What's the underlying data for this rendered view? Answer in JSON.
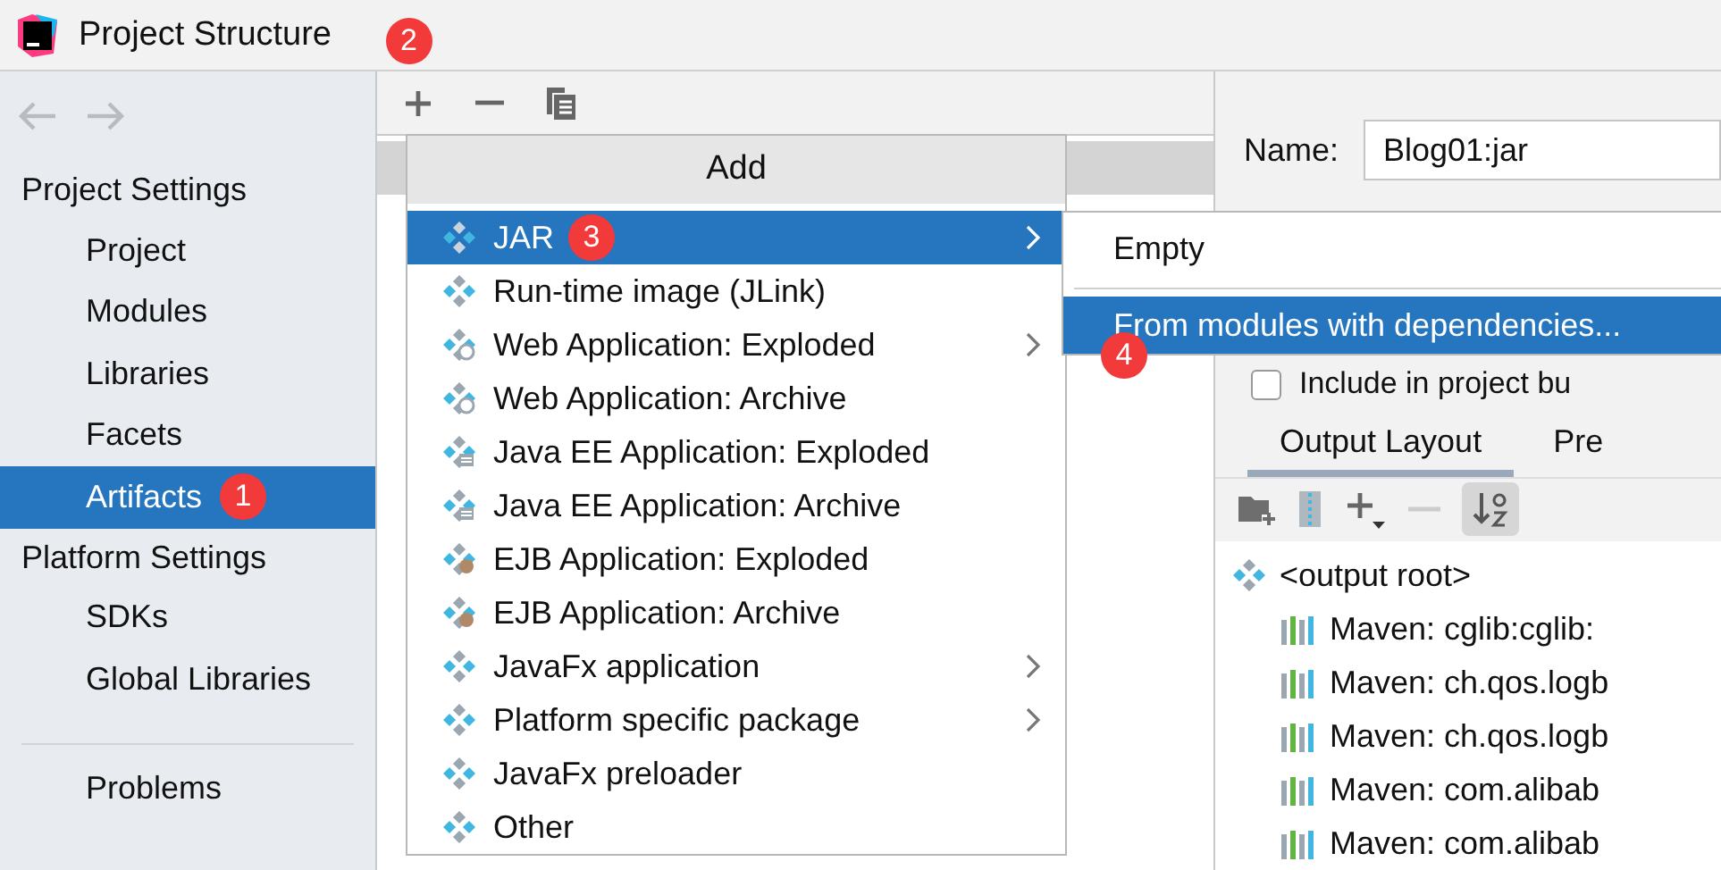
{
  "window": {
    "title": "Project Structure"
  },
  "sidebar": {
    "sections": [
      {
        "title": "Project Settings",
        "items": [
          {
            "label": "Project",
            "selected": false
          },
          {
            "label": "Modules",
            "selected": false
          },
          {
            "label": "Libraries",
            "selected": false
          },
          {
            "label": "Facets",
            "selected": false
          },
          {
            "label": "Artifacts",
            "selected": true,
            "badge": "1"
          }
        ]
      },
      {
        "title": "Platform Settings",
        "items": [
          {
            "label": "SDKs",
            "selected": false
          },
          {
            "label": "Global Libraries",
            "selected": false
          }
        ]
      }
    ],
    "footer_items": [
      {
        "label": "Problems",
        "selected": false
      }
    ]
  },
  "toolbar": {
    "add_badge": "2"
  },
  "add_menu": {
    "title": "Add",
    "items": [
      {
        "label": "JAR",
        "kind": "plain",
        "submenu": true,
        "selected": true,
        "badge": "3"
      },
      {
        "label": "Run-time image (JLink)",
        "kind": "plain",
        "submenu": false,
        "selected": false
      },
      {
        "label": "Web Application: Exploded",
        "kind": "web",
        "submenu": true,
        "selected": false
      },
      {
        "label": "Web Application: Archive",
        "kind": "web",
        "submenu": false,
        "selected": false
      },
      {
        "label": "Java EE Application: Exploded",
        "kind": "javaee",
        "submenu": false,
        "selected": false
      },
      {
        "label": "Java EE Application: Archive",
        "kind": "javaee",
        "submenu": false,
        "selected": false
      },
      {
        "label": "EJB Application: Exploded",
        "kind": "ejb",
        "submenu": false,
        "selected": false
      },
      {
        "label": "EJB Application: Archive",
        "kind": "ejb",
        "submenu": false,
        "selected": false
      },
      {
        "label": "JavaFx application",
        "kind": "plain",
        "submenu": true,
        "selected": false
      },
      {
        "label": "Platform specific package",
        "kind": "plain",
        "submenu": true,
        "selected": false
      },
      {
        "label": "JavaFx preloader",
        "kind": "plain",
        "submenu": false,
        "selected": false
      },
      {
        "label": "Other",
        "kind": "plain",
        "submenu": false,
        "selected": false
      }
    ]
  },
  "jar_submenu": {
    "items": [
      {
        "label": "Empty",
        "selected": false
      },
      {
        "label": "From modules with dependencies...",
        "selected": true,
        "badge": "4"
      }
    ]
  },
  "artifact": {
    "name_label": "Name:",
    "name_value": "Blog01:jar",
    "include_checkbox": {
      "label": "Include in project bu",
      "checked": false
    },
    "tabs": [
      {
        "label": "Output Layout",
        "selected": true
      },
      {
        "label": "Pre",
        "selected": false
      }
    ],
    "tree": [
      {
        "label": "<output root>",
        "kind": "root",
        "children": [
          {
            "label": "Maven: cglib:cglib:",
            "kind": "library"
          },
          {
            "label": "Maven: ch.qos.logb",
            "kind": "library"
          },
          {
            "label": "Maven: ch.qos.logb",
            "kind": "library"
          },
          {
            "label": "Maven: com.alibab",
            "kind": "library"
          },
          {
            "label": "Maven: com.alibab",
            "kind": "library"
          }
        ]
      }
    ]
  }
}
